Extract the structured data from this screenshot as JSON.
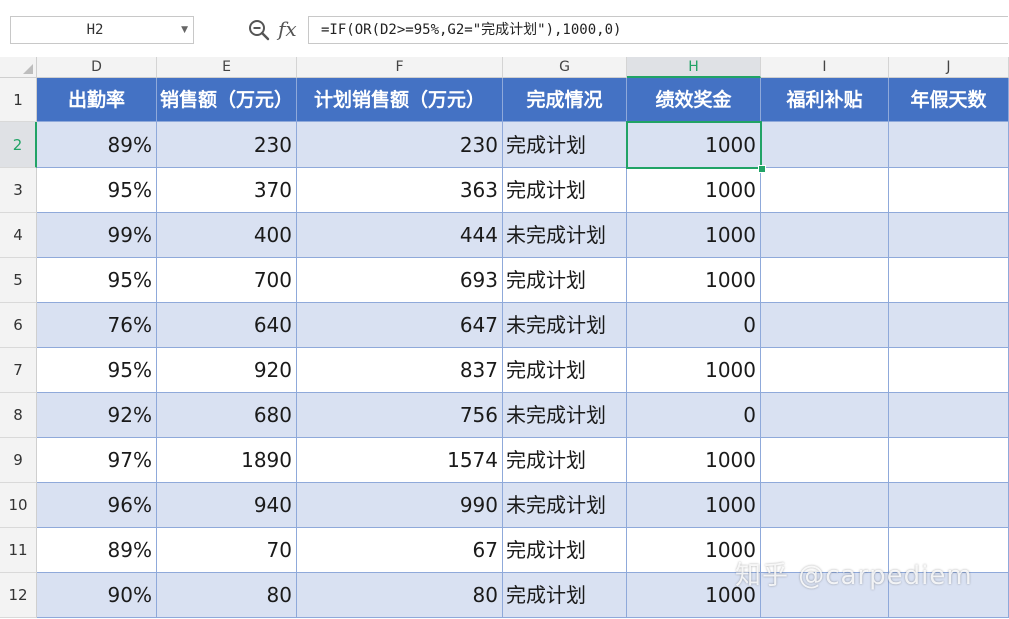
{
  "formula_bar": {
    "cell_ref": "H2",
    "formula": "=IF(OR(D2>=95%,G2=\"完成计划\"),1000,0)",
    "fx_label": "fx"
  },
  "columns": [
    "D",
    "E",
    "F",
    "G",
    "H",
    "I",
    "J"
  ],
  "active_column": "H",
  "active_row": "2",
  "row_numbers": [
    "1",
    "2",
    "3",
    "4",
    "5",
    "6",
    "7",
    "8",
    "9",
    "10",
    "11",
    "12"
  ],
  "header_row": [
    "出勤率",
    "销售额（万元）",
    "计划销售额（万元）",
    "完成情况",
    "绩效奖金",
    "福利补贴",
    "年假天数"
  ],
  "rows": [
    [
      "89%",
      "230",
      "230",
      "完成计划",
      "1000",
      "",
      ""
    ],
    [
      "95%",
      "370",
      "363",
      "完成计划",
      "1000",
      "",
      ""
    ],
    [
      "99%",
      "400",
      "444",
      "未完成计划",
      "1000",
      "",
      ""
    ],
    [
      "95%",
      "700",
      "693",
      "完成计划",
      "1000",
      "",
      ""
    ],
    [
      "76%",
      "640",
      "647",
      "未完成计划",
      "0",
      "",
      ""
    ],
    [
      "95%",
      "920",
      "837",
      "完成计划",
      "1000",
      "",
      ""
    ],
    [
      "92%",
      "680",
      "756",
      "未完成计划",
      "0",
      "",
      ""
    ],
    [
      "97%",
      "1890",
      "1574",
      "完成计划",
      "1000",
      "",
      ""
    ],
    [
      "96%",
      "940",
      "990",
      "未完成计划",
      "1000",
      "",
      ""
    ],
    [
      "89%",
      "70",
      "67",
      "完成计划",
      "1000",
      "",
      ""
    ],
    [
      "90%",
      "80",
      "80",
      "完成计划",
      "1000",
      "",
      ""
    ]
  ],
  "watermark": "知乎 @carpediem",
  "colors": {
    "header_fill": "#4472c4",
    "band_fill": "#d9e1f2",
    "selection": "#21a366"
  },
  "icons": {
    "zoom": "zoom-formula-icon",
    "fx": "fx-icon"
  }
}
